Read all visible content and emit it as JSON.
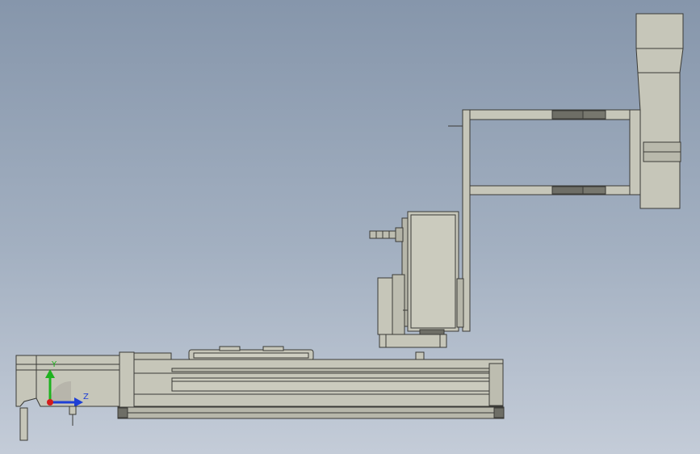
{
  "viewport": {
    "background_top": "#8696ab",
    "background_bottom": "#c4ccd8"
  },
  "model": {
    "part_fill": "#c6c6b9",
    "part_stroke": "#3a3a36",
    "shadow_fill": "#a9a99c",
    "dark_pad_fill": "#6e6e66"
  },
  "triad": {
    "y_label": "Y",
    "z_label": "Z",
    "y_color": "#1fb21f",
    "z_color": "#1e3fd6",
    "x_color": "#d41b1b"
  }
}
